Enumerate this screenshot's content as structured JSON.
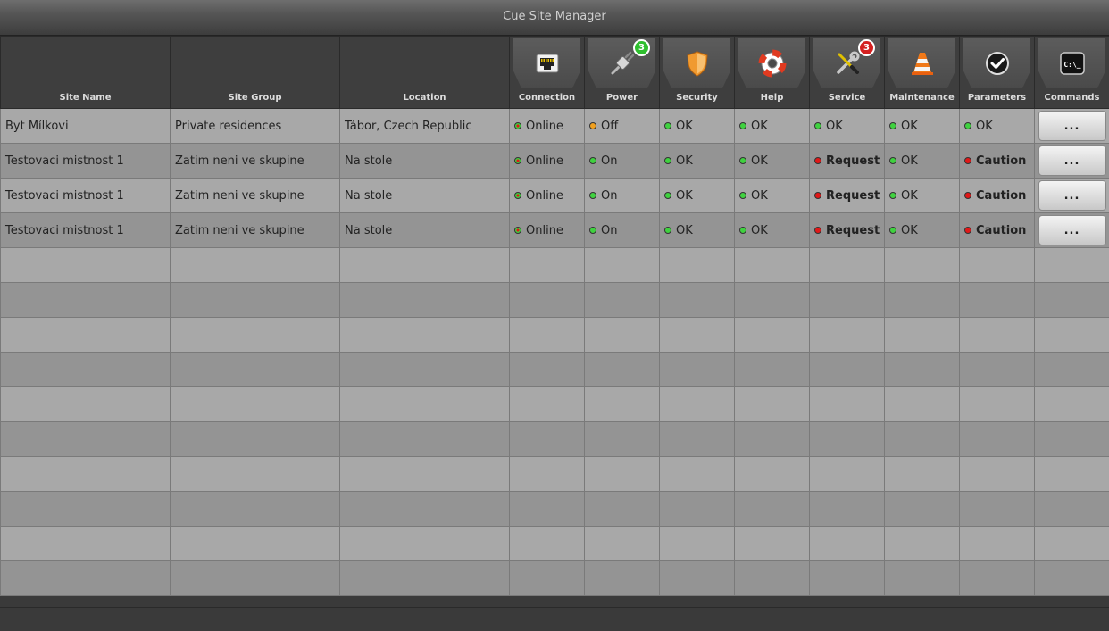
{
  "window": {
    "title": "Cue Site Manager"
  },
  "columns": {
    "site_name": "Site Name",
    "site_group": "Site Group",
    "location": "Location",
    "connection": {
      "label": "Connection",
      "icon": "ethernet-port-icon"
    },
    "power": {
      "label": "Power",
      "icon": "power-plug-icon",
      "badge": "3",
      "badge_color": "#2fbf2f"
    },
    "security": {
      "label": "Security",
      "icon": "shield-icon"
    },
    "help": {
      "label": "Help",
      "icon": "lifebuoy-icon"
    },
    "service": {
      "label": "Service",
      "icon": "wrench-screwdriver-icon",
      "badge": "3",
      "badge_color": "#d42020"
    },
    "maintenance": {
      "label": "Maintenance",
      "icon": "traffic-cone-icon"
    },
    "parameters": {
      "label": "Parameters",
      "icon": "checkmark-icon"
    },
    "commands": {
      "label": "Commands",
      "icon": "terminal-icon"
    }
  },
  "colors": {
    "green": "#3fd13f",
    "orange": "#f0a020",
    "red": "#e01818"
  },
  "rows": [
    {
      "site_name": "Byt Mílkovi",
      "site_group": "Private residences",
      "location": "Tábor, Czech Republic",
      "connection": "Online",
      "power": "Off",
      "security": "OK",
      "help": "OK",
      "service": "OK",
      "maintenance": "OK",
      "parameters": "OK",
      "commands": "..."
    },
    {
      "site_name": "Testovaci mistnost 1",
      "site_group": "Zatim neni ve skupine",
      "location": "Na stole",
      "connection": "Online",
      "power": "On",
      "security": "OK",
      "help": "OK",
      "service": "Request",
      "maintenance": "OK",
      "parameters": "Caution",
      "commands": "..."
    },
    {
      "site_name": "Testovaci mistnost 1",
      "site_group": "Zatim neni ve skupine",
      "location": "Na stole",
      "connection": "Online",
      "power": "On",
      "security": "OK",
      "help": "OK",
      "service": "Request",
      "maintenance": "OK",
      "parameters": "Caution",
      "commands": "..."
    },
    {
      "site_name": "Testovaci mistnost 1",
      "site_group": "Zatim neni ve skupine",
      "location": "Na stole",
      "connection": "Online",
      "power": "On",
      "security": "OK",
      "help": "OK",
      "service": "Request",
      "maintenance": "OK",
      "parameters": "Caution",
      "commands": "..."
    }
  ]
}
